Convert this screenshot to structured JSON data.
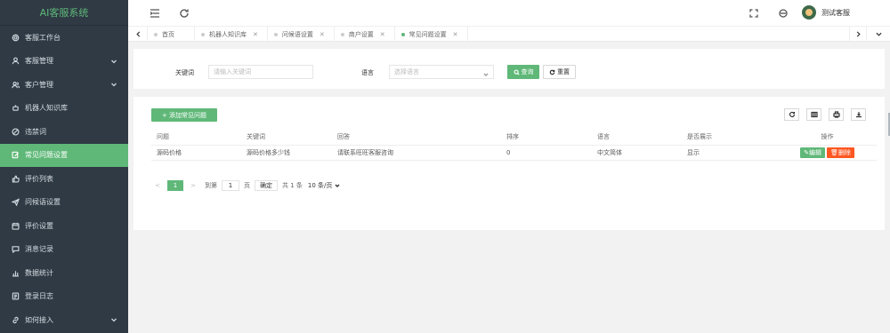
{
  "app": {
    "brand": "AI客服系统"
  },
  "sidebar": {
    "items": [
      {
        "label": "客服工作台",
        "icon": "gear-icon",
        "active": false,
        "has_children": false
      },
      {
        "label": "客服管理",
        "icon": "person-icon",
        "active": false,
        "has_children": true
      },
      {
        "label": "客户管理",
        "icon": "people-icon",
        "active": false,
        "has_children": true
      },
      {
        "label": "机器人知识库",
        "icon": "robot-icon",
        "active": false,
        "has_children": false
      },
      {
        "label": "违禁词",
        "icon": "ban-icon",
        "active": false,
        "has_children": false
      },
      {
        "label": "常见问题设置",
        "icon": "edit-icon",
        "active": true,
        "has_children": false
      },
      {
        "label": "评价列表",
        "icon": "thumb-icon",
        "active": false,
        "has_children": false
      },
      {
        "label": "问候语设置",
        "icon": "send-icon",
        "active": false,
        "has_children": false
      },
      {
        "label": "评价设置",
        "icon": "calendar-icon",
        "active": false,
        "has_children": false
      },
      {
        "label": "消息记录",
        "icon": "message-icon",
        "active": false,
        "has_children": false
      },
      {
        "label": "数据统计",
        "icon": "stats-icon",
        "active": false,
        "has_children": false
      },
      {
        "label": "登录日志",
        "icon": "log-icon",
        "active": false,
        "has_children": false
      },
      {
        "label": "如何接入",
        "icon": "link-icon",
        "active": false,
        "has_children": true
      }
    ]
  },
  "topbar": {
    "user_name": "测试客服"
  },
  "tabs": [
    {
      "label": "首页",
      "closable": false,
      "active": false
    },
    {
      "label": "机器人知识库",
      "closable": true,
      "active": false
    },
    {
      "label": "问候语设置",
      "closable": true,
      "active": false
    },
    {
      "label": "商户设置",
      "closable": true,
      "active": false
    },
    {
      "label": "常见问题设置",
      "closable": true,
      "active": true
    }
  ],
  "filter": {
    "keyword_label": "关键词",
    "keyword_placeholder": "请输入关键词",
    "language_label": "语言",
    "language_placeholder": "选择语言",
    "search_label": "查询",
    "reset_label": "重置"
  },
  "toolbar": {
    "add_label": "+ 添加常见问题"
  },
  "table": {
    "columns": [
      "问题",
      "关键词",
      "回答",
      "排序",
      "语言",
      "是否展示",
      "操作"
    ],
    "rows": [
      {
        "question": "源码价格",
        "keyword": "源码价格多少钱",
        "answer": "请联系旺旺客服咨询",
        "sort": "0",
        "language": "中文简体",
        "show": "显示",
        "edit": "编辑",
        "delete": "删除"
      }
    ]
  },
  "pager": {
    "prev": "<",
    "current": "1",
    "next": ">",
    "goto_label": "到第",
    "goto_value": "1",
    "page_unit": "页",
    "confirm": "确定",
    "total": "共 1 条",
    "page_size": "10 条/页"
  }
}
